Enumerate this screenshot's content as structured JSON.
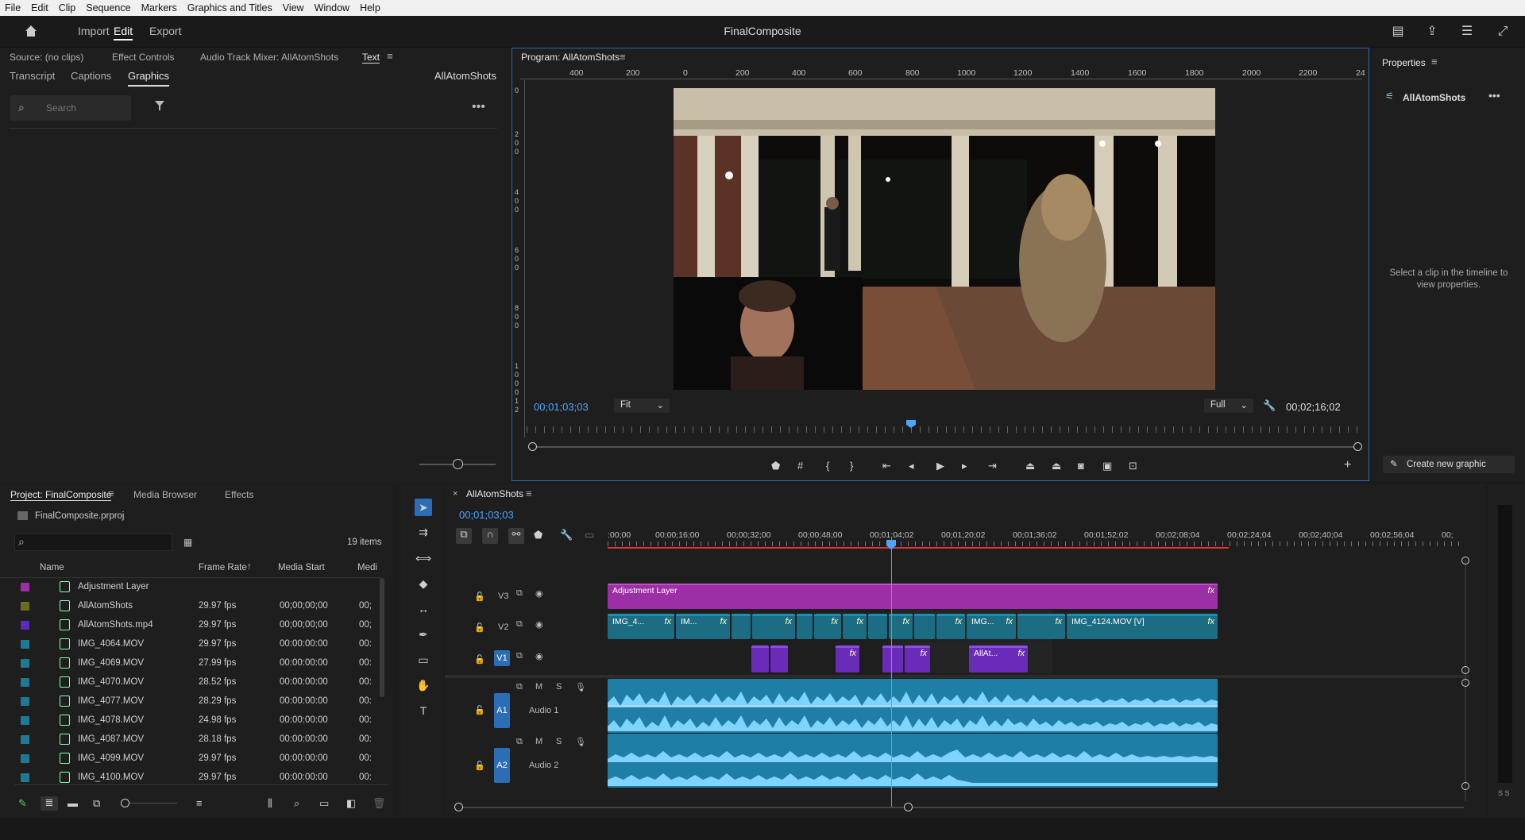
{
  "menu": [
    "File",
    "Edit",
    "Clip",
    "Sequence",
    "Markers",
    "Graphics and Titles",
    "View",
    "Window",
    "Help"
  ],
  "header": {
    "nav": [
      "Import",
      "Edit",
      "Export"
    ],
    "title": "FinalComposite"
  },
  "left_panel": {
    "tabs_row1": [
      "Source: (no clips)",
      "Effect Controls",
      "Audio Track Mixer: AllAtomShots",
      "Text"
    ],
    "tabs_row2": [
      "Transcript",
      "Captions",
      "Graphics"
    ],
    "sequence_name": "AllAtomShots",
    "search_placeholder": "Search"
  },
  "program": {
    "title": "Program: AllAtomShots",
    "ruler_h": [
      "400",
      "200",
      "0",
      "200",
      "400",
      "600",
      "800",
      "1000",
      "1200",
      "1400",
      "1600",
      "1800",
      "2000",
      "2200",
      "24"
    ],
    "ruler_v": [
      "0",
      "2",
      "0",
      "0",
      "4",
      "0",
      "0",
      "6",
      "0",
      "0",
      "8",
      "0",
      "0",
      "1",
      "0",
      "0",
      "0",
      "1",
      "2"
    ],
    "timecode": "00;01;03;03",
    "fit": "Fit",
    "quality": "Full",
    "duration": "00;02;16;02",
    "playhead_fraction": 0.46
  },
  "properties": {
    "title": "Properties",
    "item": "AllAtomShots",
    "hint": "Select a clip in the timeline to view properties.",
    "create_button": "Create new graphic"
  },
  "project": {
    "tabs": [
      "Project: FinalComposite",
      "Media Browser",
      "Effects"
    ],
    "file": "FinalComposite.prproj",
    "count": "19 items",
    "columns": [
      "Name",
      "Frame Rate",
      "Media Start",
      "Medi"
    ],
    "rows": [
      {
        "color": "#9a2fa8",
        "name": "Adjustment Layer",
        "rate": "",
        "start": "",
        "end": ""
      },
      {
        "color": "#6e6a1e",
        "name": "AllAtomShots",
        "rate": "29.97 fps",
        "start": "00;00;00;00",
        "end": "00;"
      },
      {
        "color": "#5b2bc0",
        "name": "AllAtomShots.mp4",
        "rate": "29.97 fps",
        "start": "00;00;00;00",
        "end": "00;"
      },
      {
        "color": "#1c7a94",
        "name": "IMG_4064.MOV",
        "rate": "29.97 fps",
        "start": "00:00:00:00",
        "end": "00:"
      },
      {
        "color": "#1c7a94",
        "name": "IMG_4069.MOV",
        "rate": "27.99 fps",
        "start": "00:00:00:00",
        "end": "00:"
      },
      {
        "color": "#1c7a94",
        "name": "IMG_4070.MOV",
        "rate": "28.52 fps",
        "start": "00:00:00:00",
        "end": "00:"
      },
      {
        "color": "#1c7a94",
        "name": "IMG_4077.MOV",
        "rate": "28.29 fps",
        "start": "00:00:00:00",
        "end": "00:"
      },
      {
        "color": "#1c7a94",
        "name": "IMG_4078.MOV",
        "rate": "24.98 fps",
        "start": "00:00:00:00",
        "end": "00:"
      },
      {
        "color": "#1c7a94",
        "name": "IMG_4087.MOV",
        "rate": "28.18 fps",
        "start": "00:00:00:00",
        "end": "00:"
      },
      {
        "color": "#1c7a94",
        "name": "IMG_4099.MOV",
        "rate": "29.97 fps",
        "start": "00:00:00:00",
        "end": "00:"
      },
      {
        "color": "#1c7a94",
        "name": "IMG_4100.MOV",
        "rate": "29.97 fps",
        "start": "00:00:00:00",
        "end": "00:"
      }
    ]
  },
  "timeline": {
    "tab": "AllAtomShots",
    "timecode": "00;01;03;03",
    "ruler": [
      ":00;00",
      "00;00;16;00",
      "00;00;32;00",
      "00;00;48;00",
      "00;01;04;02",
      "00;01;20;02",
      "00;01;36;02",
      "00;01;52;02",
      "00;02;08;04",
      "00;02;24;04",
      "00;02;40;04",
      "00;02;56;04",
      "00;"
    ],
    "tracks": {
      "v3": "V3",
      "v2": "V2",
      "v1": "V1",
      "a1": "A1",
      "a2": "A2",
      "audio1": "Audio 1",
      "audio2": "Audio 2"
    },
    "adj_label": "Adjustment Layer",
    "v2_labels": [
      "IMG_4...",
      "IM...",
      "IMG...",
      "IMG_4124.MOV [V]"
    ],
    "v1_label": "AllAt...",
    "fx": "fx"
  }
}
